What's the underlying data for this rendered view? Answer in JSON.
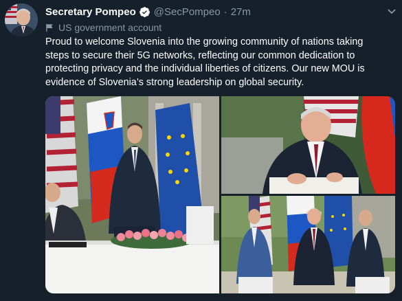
{
  "tweet": {
    "author_name": "Secretary Pompeo",
    "handle": "@SecPompeo",
    "separator": "·",
    "time": "27m",
    "account_label": "US government account",
    "text": "Proud to welcome Slovenia into the growing community of nations taking steps to secure their 5G networks, reflecting our common dedication to protecting privacy and the individual liberties of citizens. Our new MOU is evidence of Slovenia’s strong leadership on global security.",
    "icons": {
      "verified": "verified-badge-icon",
      "label": "flag-icon",
      "menu": "chevron-down-icon"
    },
    "colors": {
      "background": "#15202b",
      "secondary_text": "#8899a6",
      "verified": "#ffffff"
    }
  }
}
